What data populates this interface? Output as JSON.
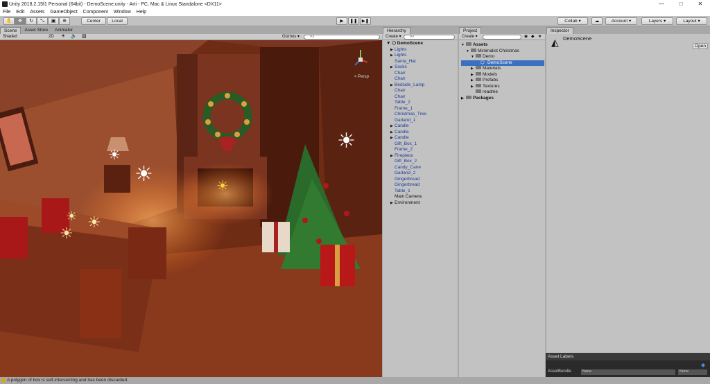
{
  "window": {
    "title": "Unity 2018.2.15f1 Personal (64bit) - DemoScene.unity - Arti - PC, Mac & Linux Standalone <DX11>",
    "minimize": "—",
    "maximize": "□",
    "close": "✕"
  },
  "menu": [
    "File",
    "Edit",
    "Assets",
    "GameObject",
    "Component",
    "Window",
    "Help"
  ],
  "toolbar": {
    "center": "Center",
    "local": "Local",
    "collab": "Collab ▾",
    "account": "Account ▾",
    "layers": "Layers ▾",
    "layout": "Layout ▾",
    "play": "▶",
    "pause": "❚❚",
    "step": "▶❚"
  },
  "scene_tabs": [
    "Scene",
    "Asset Store",
    "Animator"
  ],
  "scene_bar": {
    "shading": "Shaded",
    "mode2d": "2D",
    "gizmos": "Gizmos ▾",
    "search": "All"
  },
  "persp": "< Persp",
  "hierarchy": {
    "tab": "Hierarchy",
    "create": "Create ▾",
    "search": "All",
    "root": "DemoScene",
    "items": [
      {
        "label": "Lights",
        "arrow": "▶",
        "blue": true
      },
      {
        "label": "Lights",
        "arrow": "▶",
        "blue": true
      },
      {
        "label": "Santa_Hat",
        "arrow": "",
        "blue": true
      },
      {
        "label": "Socks",
        "arrow": "▶",
        "blue": true
      },
      {
        "label": "Chair",
        "arrow": "",
        "blue": true
      },
      {
        "label": "Chair",
        "arrow": "",
        "blue": true
      },
      {
        "label": "Bedside_Lamp",
        "arrow": "▶",
        "blue": true
      },
      {
        "label": "Chair",
        "arrow": "",
        "blue": true
      },
      {
        "label": "Chair",
        "arrow": "",
        "blue": true
      },
      {
        "label": "Table_2",
        "arrow": "",
        "blue": true
      },
      {
        "label": "Frame_1",
        "arrow": "",
        "blue": true
      },
      {
        "label": "Christmas_Tree",
        "arrow": "",
        "blue": true
      },
      {
        "label": "Garland_1",
        "arrow": "",
        "blue": true
      },
      {
        "label": "Candle",
        "arrow": "▶",
        "blue": true
      },
      {
        "label": "Candle",
        "arrow": "▶",
        "blue": true
      },
      {
        "label": "Candle",
        "arrow": "▶",
        "blue": true
      },
      {
        "label": "Gift_Box_1",
        "arrow": "",
        "blue": true
      },
      {
        "label": "Frame_2",
        "arrow": "",
        "blue": true
      },
      {
        "label": "Fireplace",
        "arrow": "▶",
        "blue": true
      },
      {
        "label": "Gift_Box_2",
        "arrow": "",
        "blue": true
      },
      {
        "label": "Candy_Cane",
        "arrow": "",
        "blue": true
      },
      {
        "label": "Garland_2",
        "arrow": "",
        "blue": true
      },
      {
        "label": "Gingerbread",
        "arrow": "",
        "blue": true
      },
      {
        "label": "Gingerbread",
        "arrow": "",
        "blue": true
      },
      {
        "label": "Table_1",
        "arrow": "",
        "blue": true
      },
      {
        "label": "Main Camera",
        "arrow": "",
        "blue": false
      },
      {
        "label": "Environment",
        "arrow": "▶",
        "blue": false
      }
    ]
  },
  "project": {
    "tab": "Project",
    "create": "Create ▾",
    "items": [
      {
        "label": "Assets",
        "indent": 0,
        "arrow": "▼",
        "bold": true,
        "sel": false
      },
      {
        "label": "Minimalist Christmas",
        "indent": 1,
        "arrow": "▼",
        "bold": false,
        "sel": false
      },
      {
        "label": "Demo",
        "indent": 2,
        "arrow": "▼",
        "bold": false,
        "sel": false
      },
      {
        "label": "DemoScene",
        "indent": 3,
        "arrow": "",
        "bold": false,
        "sel": true
      },
      {
        "label": "Materials",
        "indent": 2,
        "arrow": "▶",
        "bold": false,
        "sel": false
      },
      {
        "label": "Models",
        "indent": 2,
        "arrow": "▶",
        "bold": false,
        "sel": false
      },
      {
        "label": "Prefabs",
        "indent": 2,
        "arrow": "▶",
        "bold": false,
        "sel": false
      },
      {
        "label": "Textures",
        "indent": 2,
        "arrow": "▶",
        "bold": false,
        "sel": false
      },
      {
        "label": "readme",
        "indent": 2,
        "arrow": "",
        "bold": false,
        "sel": false
      },
      {
        "label": "Packages",
        "indent": 0,
        "arrow": "▶",
        "bold": true,
        "sel": false
      }
    ]
  },
  "inspector": {
    "tab": "Inspector",
    "name": "DemoScene",
    "open": "Open"
  },
  "asset_labels": {
    "title": "Asset Labels",
    "bundle_label": "AssetBundle",
    "bundle_value": "None",
    "variant_value": "None"
  },
  "status": "A polygon of box is self-intersecting and has been discarded."
}
